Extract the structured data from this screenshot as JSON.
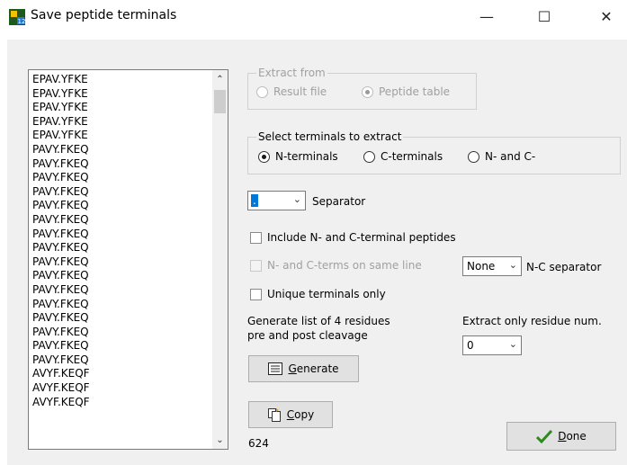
{
  "window": {
    "title": "Save peptide terminals",
    "minimize_glyph": "—",
    "maximize_glyph": "☐",
    "close_glyph": "✕",
    "app_icon": "peptide-app-icon"
  },
  "peptide_list": {
    "items": [
      "EPAV.YFKE",
      "EPAV.YFKE",
      "EPAV.YFKE",
      "EPAV.YFKE",
      "EPAV.YFKE",
      "PAVY.FKEQ",
      "PAVY.FKEQ",
      "PAVY.FKEQ",
      "PAVY.FKEQ",
      "PAVY.FKEQ",
      "PAVY.FKEQ",
      "PAVY.FKEQ",
      "PAVY.FKEQ",
      "PAVY.FKEQ",
      "PAVY.FKEQ",
      "PAVY.FKEQ",
      "PAVY.FKEQ",
      "PAVY.FKEQ",
      "PAVY.FKEQ",
      "PAVY.FKEQ",
      "PAVY.FKEQ",
      "AVYF.KEQF",
      "AVYF.KEQF",
      "AVYF.KEQF"
    ],
    "scroll_up_glyph": "⌃",
    "scroll_down_glyph": "⌄"
  },
  "extract_from": {
    "legend": "Extract from",
    "options": [
      "Result file",
      "Peptide table"
    ],
    "selected": "Peptide table",
    "enabled": false
  },
  "select_terminals": {
    "legend": "Select terminals to extract",
    "options": [
      "N-terminals",
      "C-terminals",
      "N- and C-"
    ],
    "selected": "N-terminals"
  },
  "separator": {
    "value": ".",
    "label": "Separator",
    "arrow": "⌄"
  },
  "include_terminal_peptides": {
    "label": "Include N- and C-terminal peptides",
    "checked": false
  },
  "same_line": {
    "label": "N- and C-terms on same line",
    "checked": false,
    "enabled": false
  },
  "nc_separator": {
    "value": "None",
    "label": "N-C separator",
    "arrow": "⌄"
  },
  "unique_only": {
    "label": "Unique terminals only",
    "checked": false
  },
  "generate_desc": {
    "line1": "Generate list of 4 residues",
    "line2": "pre and post cleavage"
  },
  "extract_residue": {
    "label": "Extract only residue num.",
    "value": "0",
    "arrow": "⌄"
  },
  "buttons": {
    "generate": {
      "accel": "G",
      "rest": "enerate",
      "icon": "list-icon"
    },
    "copy": {
      "accel": "C",
      "rest": "opy",
      "icon": "copy-icon"
    },
    "done": {
      "accel": "D",
      "rest": "one",
      "icon": "checkmark-icon"
    }
  },
  "count": "624",
  "colors": {
    "accent_check": "#2f8a1e",
    "selection": "#0078d7"
  }
}
